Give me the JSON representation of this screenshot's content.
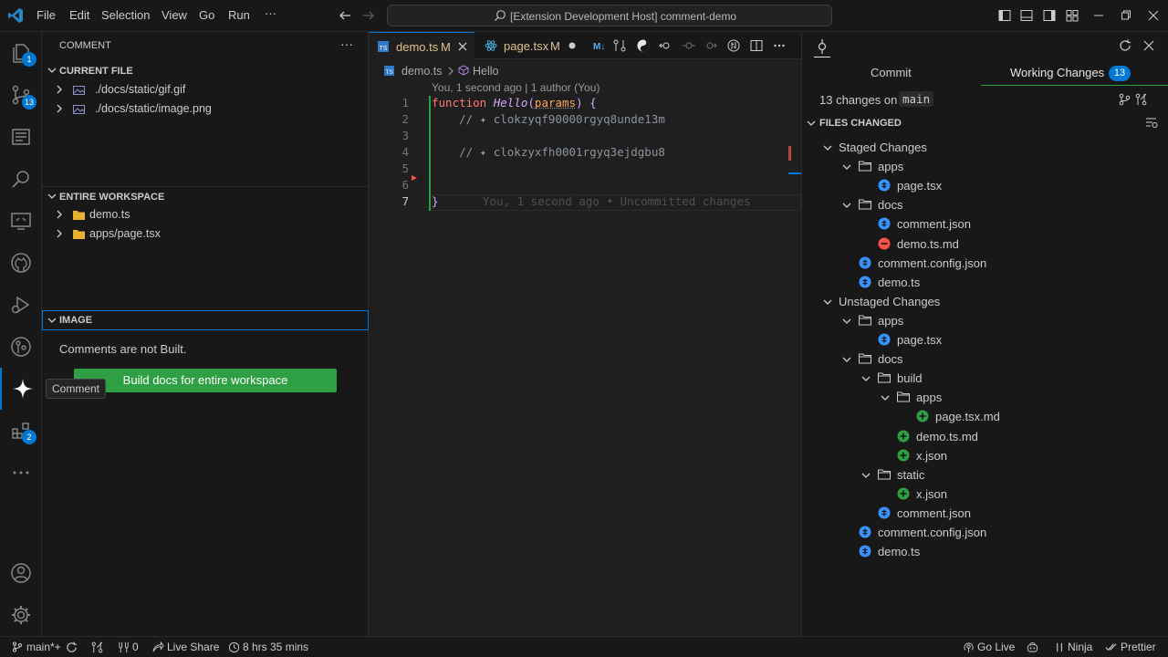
{
  "titlebar": {
    "menu": [
      "File",
      "Edit",
      "Selection",
      "View",
      "Go",
      "Run",
      "···"
    ],
    "command_center": "[Extension Development Host] comment-demo"
  },
  "activitybar": {
    "explorer_badge": "1",
    "scm_badge": "13",
    "extensions_badge": "2",
    "tooltip": "Comment"
  },
  "sidebar": {
    "title": "COMMENT",
    "more": "···",
    "current_file": {
      "header": "CURRENT FILE",
      "items": [
        "./docs/static/gif.gif",
        "./docs/static/image.png"
      ]
    },
    "workspace": {
      "header": "ENTIRE WORKSPACE",
      "items": [
        "demo.ts",
        "apps/page.tsx"
      ]
    },
    "image": {
      "header": "IMAGE",
      "message": "Comments are not Built.",
      "build_button": "Build docs for entire workspace"
    }
  },
  "editor": {
    "tabs": [
      {
        "label": "demo.ts",
        "status": "M"
      },
      {
        "label": "page.tsx",
        "status": "M"
      }
    ],
    "breadcrumb": {
      "file": "demo.ts",
      "symbol": "Hello"
    },
    "codelens": "You, 1 second ago | 1 author (You)",
    "line_numbers": [
      "1",
      "2",
      "3",
      "4",
      "5",
      "6",
      "7"
    ],
    "code": {
      "kw": "function",
      "fn": "Hello",
      "open": "(",
      "param": "params",
      "close_open": ") {",
      "line2": "    // ✦ clokzyqf90000rgyq8unde13m",
      "line4": "    // ✦ clokzyxfh0001rgyq3ejdgbu8",
      "line7": "}",
      "blame": "You, 1 second ago • Uncommitted changes"
    }
  },
  "scm": {
    "tab_commit": "Commit",
    "tab_working": "Working Changes",
    "working_count": "13",
    "changes_on": "13 changes on",
    "branch": "main",
    "files_changed": "FILES CHANGED",
    "staged_label": "Staged Changes",
    "unstaged_label": "Unstaged Changes",
    "staged": {
      "apps": "apps",
      "apps_page": "page.tsx",
      "docs": "docs",
      "docs_comment": "comment.json",
      "docs_demo_md": "demo.ts.md",
      "comment_config": "comment.config.json",
      "demo_ts": "demo.ts"
    },
    "unstaged": {
      "apps": "apps",
      "apps_page": "page.tsx",
      "docs": "docs",
      "build": "build",
      "build_apps": "apps",
      "build_apps_page_md": "page.tsx.md",
      "build_demo_md": "demo.ts.md",
      "build_x": "x.json",
      "static": "static",
      "static_x": "x.json",
      "docs_comment": "comment.json",
      "comment_config": "comment.config.json",
      "demo_ts": "demo.ts"
    }
  },
  "statusbar": {
    "branch": "main*+",
    "problems": "0",
    "live_share": "Live Share",
    "time": "8 hrs 35 mins",
    "go_live": "Go Live",
    "ninja": "Ninja",
    "prettier": "Prettier"
  },
  "colors": {
    "accent": "#0078d4",
    "modified": "#e2c08d",
    "added": "#2ea043",
    "deleted": "#f85149",
    "button": "#2ea043"
  }
}
